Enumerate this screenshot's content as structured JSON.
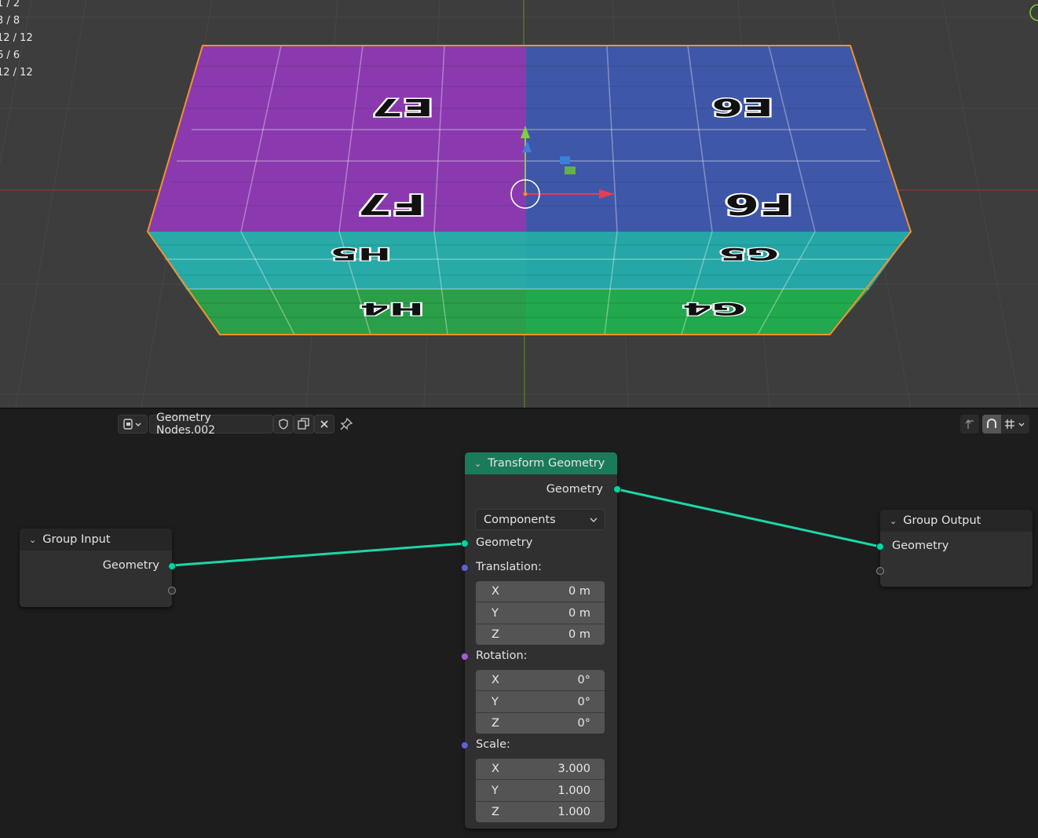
{
  "viewport": {
    "stats": [
      "1 / 2",
      "3 / 8",
      "12 / 12",
      "6 / 6",
      "12 / 12"
    ],
    "faces": {
      "e7": "E7",
      "e6": "E6",
      "f7": "F7",
      "f6": "F6",
      "h5": "H5",
      "g5": "G5",
      "h4": "H4",
      "g4": "G4"
    }
  },
  "header": {
    "node_tree_name": "Geometry Nodes.002"
  },
  "nodes": {
    "group_input": {
      "title": "Group Input",
      "output": "Geometry"
    },
    "transform": {
      "title": "Transform Geometry",
      "output": "Geometry",
      "mode": "Components",
      "input_geometry": "Geometry",
      "translation": {
        "label": "Translation:",
        "x_label": "X",
        "x": "0 m",
        "y_label": "Y",
        "y": "0 m",
        "z_label": "Z",
        "z": "0 m"
      },
      "rotation": {
        "label": "Rotation:",
        "x_label": "X",
        "x": "0°",
        "y_label": "Y",
        "y": "0°",
        "z_label": "Z",
        "z": "0°"
      },
      "scale": {
        "label": "Scale:",
        "x_label": "X",
        "x": "3.000",
        "y_label": "Y",
        "y": "1.000",
        "z_label": "Z",
        "z": "1.000"
      }
    },
    "group_output": {
      "title": "Group Output",
      "input": "Geometry"
    }
  },
  "colors": {
    "geometry_socket": "#00d6a3",
    "vector_socket": "#6363c7",
    "rotation_socket": "#a35fd0",
    "transform_header": "#1b7a5c",
    "selection_outline": "#f0922e"
  }
}
